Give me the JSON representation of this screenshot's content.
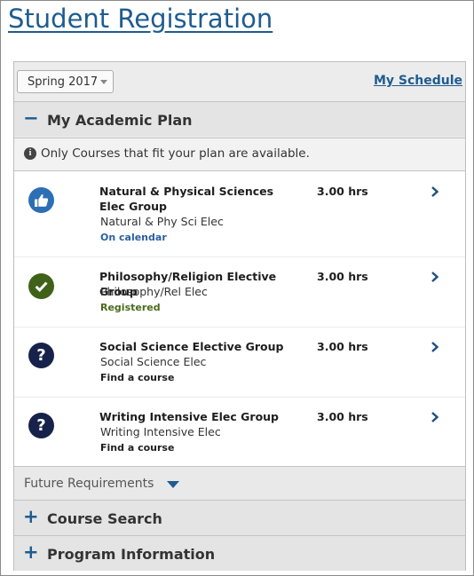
{
  "page": {
    "title": "Student Registration"
  },
  "toolbar": {
    "term": "Spring 2017",
    "my_schedule": "My Schedule"
  },
  "academic_plan": {
    "header": "My Academic Plan",
    "toggle": "−",
    "info": "Only Courses that fit your plan are available.",
    "courses": [
      {
        "name": "Natural & Physical Sciences Elec Group",
        "short": "Natural & Phy Sci Elec",
        "status": "On calendar",
        "status_color": "#2a5fa0",
        "icon": "thumbs-up-icon",
        "hours": "3.00 hrs"
      },
      {
        "name": "Philosophy/Religion Elective Group",
        "short": "Philosophy/Rel Elec",
        "status": "Registered",
        "status_color": "#4a6b1c",
        "icon": "check-icon",
        "hours": "3.00 hrs"
      },
      {
        "name": "Social Science Elective Group",
        "short": "Social Science Elec",
        "status": "Find a course",
        "status_color": "#1e1e1e",
        "icon": "question-icon",
        "hours": "3.00 hrs"
      },
      {
        "name": "Writing Intensive Elec Group",
        "short": "Writing Intensive Elec",
        "status": "Find a course",
        "status_color": "#1e1e1e",
        "icon": "question-icon",
        "hours": "3.00 hrs"
      }
    ]
  },
  "future_requirements": {
    "label": "Future Requirements"
  },
  "sections": [
    {
      "label": "Course Search",
      "toggle": "+"
    },
    {
      "label": "Program Information",
      "toggle": "+"
    }
  ],
  "colors": {
    "accent": "#1f5c8f",
    "question_badge": "#16224a",
    "like_badge": "#2c6fb4",
    "check_badge": "#3f6218"
  }
}
